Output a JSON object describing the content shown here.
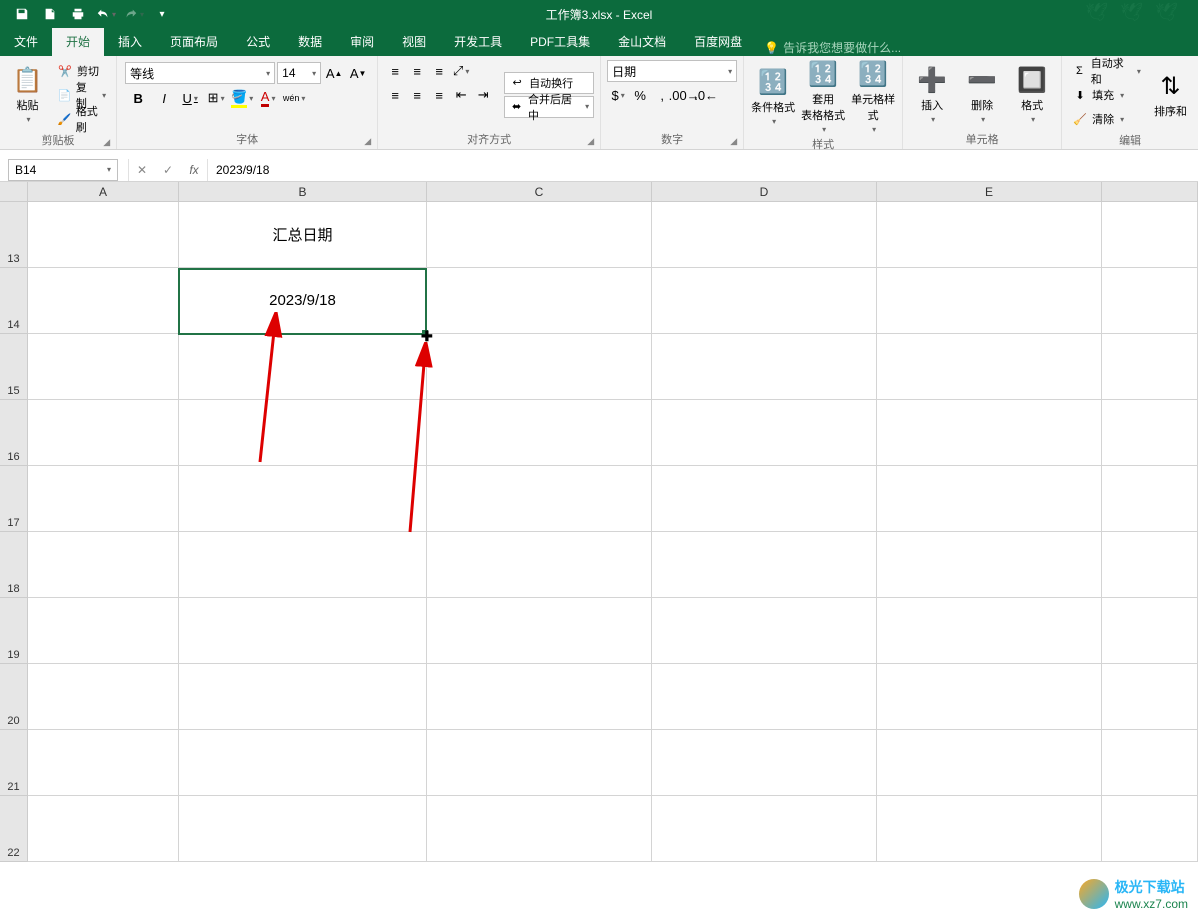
{
  "title": "工作簿3.xlsx - Excel",
  "tabs": [
    "文件",
    "开始",
    "插入",
    "页面布局",
    "公式",
    "数据",
    "审阅",
    "视图",
    "开发工具",
    "PDF工具集",
    "金山文档",
    "百度网盘"
  ],
  "active_tab": 1,
  "tell_me": "告诉我您想要做什么...",
  "clipboard": {
    "label": "剪贴板",
    "paste": "粘贴",
    "cut": "剪切",
    "copy": "复制",
    "painter": "格式刷"
  },
  "font": {
    "label": "字体",
    "name": "等线",
    "size": "14"
  },
  "align": {
    "label": "对齐方式",
    "wrap": "自动换行",
    "merge": "合并后居中"
  },
  "number": {
    "label": "数字",
    "format": "日期"
  },
  "styles": {
    "label": "样式",
    "cond": "条件格式",
    "table": "套用\n表格格式",
    "cell": "单元格样式"
  },
  "cells": {
    "label": "单元格",
    "insert": "插入",
    "delete": "删除",
    "format": "格式"
  },
  "editing": {
    "label": "编辑",
    "sum": "自动求和",
    "fill": "填充",
    "clear": "清除",
    "sort": "排序和"
  },
  "name_box": "B14",
  "formula": "2023/9/18",
  "columns": [
    "A",
    "B",
    "C",
    "D",
    "E"
  ],
  "row_headers": [
    "13",
    "14",
    "15",
    "16",
    "17",
    "18",
    "19",
    "20",
    "21",
    "22"
  ],
  "cell_b13": "汇总日期",
  "cell_b14": "2023/9/18",
  "watermark": {
    "name": "极光下载站",
    "url": "www.xz7.com"
  }
}
